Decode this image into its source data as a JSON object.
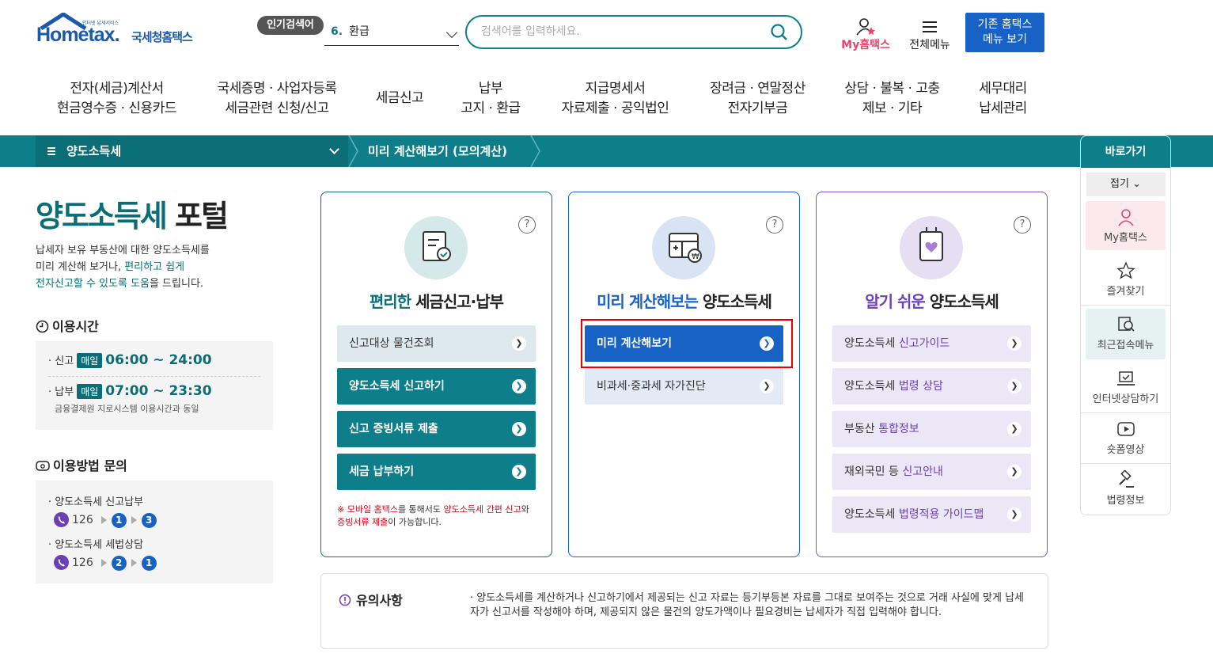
{
  "header": {
    "logo_small": "인터넷 납세서비스",
    "logo_home": "Hometax.",
    "logo_kr": "국세청홈택스",
    "popular_label": "인기검색어",
    "popular_num": "6.",
    "popular_word": "환급",
    "search_placeholder": "검색어를 입력하세요.",
    "my_hometax": "My홈택스",
    "all_menu": "전체메뉴",
    "old_menu_line1": "기존 홈택스",
    "old_menu_line2": "메뉴 보기"
  },
  "gnb": [
    {
      "l1": "전자(세금)계산서",
      "l2": "현금영수증 · 신용카드"
    },
    {
      "l1": "국세증명 · 사업자등록",
      "l2": "세금관련 신청/신고"
    },
    {
      "l1": "세금신고",
      "l2": ""
    },
    {
      "l1": "납부",
      "l2": "고지 · 환급"
    },
    {
      "l1": "지급명세서",
      "l2": "자료제출 · 공익법인"
    },
    {
      "l1": "장려금 · 연말정산",
      "l2": "전자기부금"
    },
    {
      "l1": "상담 · 불복 · 고충",
      "l2": "제보 · 기타"
    },
    {
      "l1": "세무대리",
      "l2": "납세관리"
    }
  ],
  "breadcrumb": {
    "category": "양도소득세",
    "page": "미리 계산해보기 (모의계산)"
  },
  "left": {
    "title_a": "양도소득세",
    "title_b": "포털",
    "desc1": "납세자 보유 부동산에 대한 양도소득세를",
    "desc2a": "미리 계산해 보거나, ",
    "desc2b": "편리하고 쉽게",
    "desc3a": "전자신고할 수 있도록 도움",
    "desc3b": "을 드립니다.",
    "hours_title": "이용시간",
    "report_label": "· 신고",
    "report_pill": "매일",
    "report_time": "06:00 ~ 24:00",
    "pay_label": "· 납부",
    "pay_pill": "매일",
    "pay_time": "07:00 ~ 23:30",
    "pay_note": "금융결제원 지로시스템 이용시간과 동일",
    "inquiry_title": "이용방법 문의",
    "inq1_label": "· 양도소득세 신고납부",
    "inq1_num": "126",
    "inq1_s1": "1",
    "inq1_s2": "3",
    "inq2_label": "· 양도소득세 세법상담",
    "inq2_num": "126",
    "inq2_s1": "2",
    "inq2_s2": "1"
  },
  "card1": {
    "title_a": "편리한",
    "title_b": " 세금신고·납부",
    "btn1": "신고대상 물건조회",
    "btn2": "양도소득세 신고하기",
    "btn3": "신고 증빙서류 제출",
    "btn4": "세금 납부하기",
    "note_a": "※ ",
    "note_b": "모바일 홈택스",
    "note_c": "를 통해서도 ",
    "note_d": "양도소득세 간편 신고",
    "note_e": "와 ",
    "note_f": "증빙서류 제출",
    "note_g": "이 가능합니다."
  },
  "card2": {
    "title_a": "미리 계산해보는",
    "title_b": " 양도소득세",
    "btn1": "미리 계산해보기",
    "btn2": "비과세·중과세 자가진단"
  },
  "card3": {
    "title_a": "알기 쉬운",
    "title_b": " 양도소득세",
    "btn1a": "양도소득세 ",
    "btn1b": "신고가이드",
    "btn2a": "양도소득세 ",
    "btn2b": "법령 상담",
    "btn3a": "부동산 ",
    "btn3b": "통합정보",
    "btn4a": "재외국민 등 ",
    "btn4b": "신고안내",
    "btn5a": "양도소득세 ",
    "btn5b": "법령적용 가이드맵"
  },
  "notice": {
    "title": "유의사항",
    "text": "· 양도소득세를 계산하거나 신고하기에서 제공되는 신고 자료는 등기부등본 자료를 그대로 보여주는 것으로 거래 사실에 맞게 납세자가 신고서를 작성해야 하며, 제공되지 않은 물건의 양도가액이나 필요경비는 납세자가 직접 입력해야 합니다."
  },
  "quick": {
    "title": "바로가기",
    "fold": "접기",
    "items": [
      "My홈택스",
      "즐겨찾기",
      "최근접속메뉴",
      "인터넷상담하기",
      "숏폼영상",
      "법령정보"
    ]
  }
}
